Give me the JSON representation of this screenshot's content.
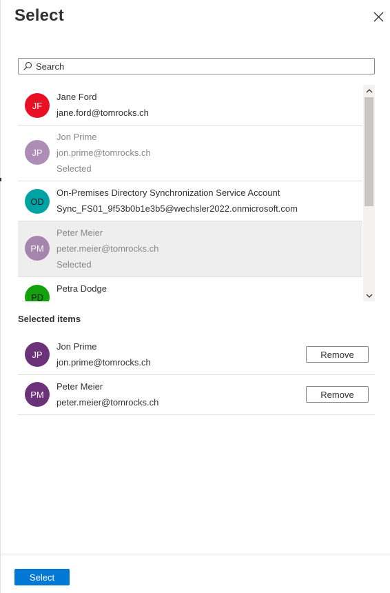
{
  "panel": {
    "title": "Select"
  },
  "search": {
    "placeholder": "Search",
    "value": ""
  },
  "results": [
    {
      "initials": "JF",
      "name": "Jane Ford",
      "email": "jane.ford@tomrocks.ch",
      "status": "",
      "color": "#e81123",
      "selected": false
    },
    {
      "initials": "JP",
      "name": "Jon Prime",
      "email": "jon.prime@tomrocks.ch",
      "status": "Selected",
      "color": "#6b3179",
      "selected": false
    },
    {
      "initials": "OD",
      "name": "On-Premises Directory Synchronization Service Account",
      "email": "Sync_FS01_9f53b0b1e3b5@wechsler2022.onmicrosoft.com",
      "status": "",
      "color": "#00a3a3",
      "selected": false
    },
    {
      "initials": "PM",
      "name": "Peter Meier",
      "email": "peter.meier@tomrocks.ch",
      "status": "Selected",
      "color": "#6b3179",
      "selected": true
    },
    {
      "initials": "PD",
      "name": "Petra Dodge",
      "email": "",
      "status": "",
      "color": "#13a10e",
      "selected": false
    }
  ],
  "selected_section": {
    "heading": "Selected items",
    "items": [
      {
        "initials": "JP",
        "name": "Jon Prime",
        "email": "jon.prime@tomrocks.ch",
        "remove_label": "Remove"
      },
      {
        "initials": "PM",
        "name": "Peter Meier",
        "email": "peter.meier@tomrocks.ch",
        "remove_label": "Remove"
      }
    ]
  },
  "footer": {
    "select_label": "Select"
  },
  "icons": {
    "close": "close-icon",
    "search": "search-icon",
    "scroll_up": "chevron-up-icon",
    "scroll_down": "chevron-down-icon"
  }
}
